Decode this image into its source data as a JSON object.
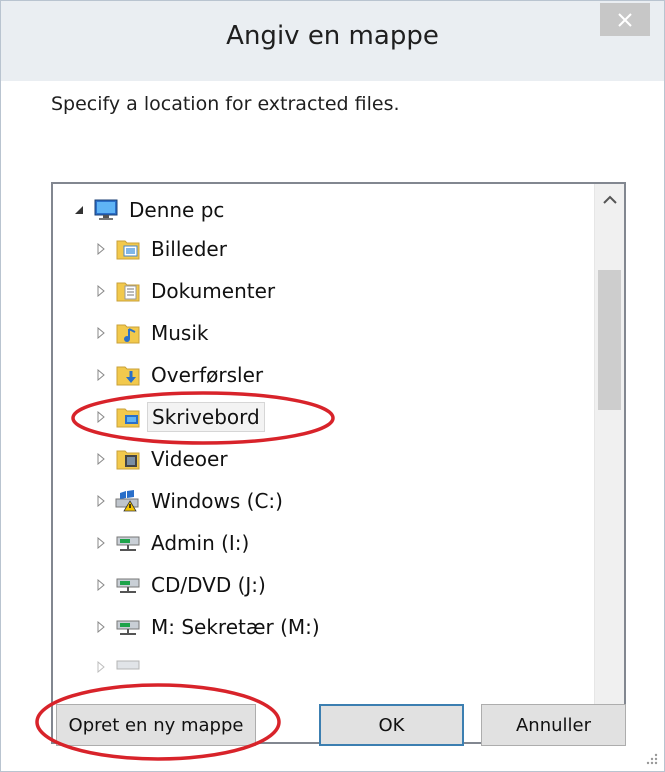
{
  "window": {
    "title": "Angiv en mappe",
    "close_icon": "close-icon"
  },
  "prompt": "Specify a location for extracted files.",
  "tree": {
    "root": {
      "label": "Denne pc",
      "icon": "computer-icon",
      "expanded": true
    },
    "items": [
      {
        "label": "Billeder",
        "icon": "pictures-folder-icon"
      },
      {
        "label": "Dokumenter",
        "icon": "documents-folder-icon"
      },
      {
        "label": "Musik",
        "icon": "music-folder-icon"
      },
      {
        "label": "Overførsler",
        "icon": "downloads-folder-icon"
      },
      {
        "label": "Skrivebord",
        "icon": "desktop-folder-icon",
        "selected": true,
        "highlighted": true
      },
      {
        "label": "Videoer",
        "icon": "videos-folder-icon"
      },
      {
        "label": "Windows (C:)",
        "icon": "system-drive-icon"
      },
      {
        "label": "Admin (I:)",
        "icon": "network-drive-icon"
      },
      {
        "label": "CD/DVD (J:)",
        "icon": "network-drive-icon"
      },
      {
        "label": "M: Sekretær (M:)",
        "icon": "network-drive-icon"
      }
    ]
  },
  "buttons": {
    "new_folder": "Opret en ny mappe",
    "ok": "OK",
    "cancel": "Annuller"
  },
  "colors": {
    "annotation_red": "#d8232a",
    "folder_yellow": "#f2c94c"
  }
}
